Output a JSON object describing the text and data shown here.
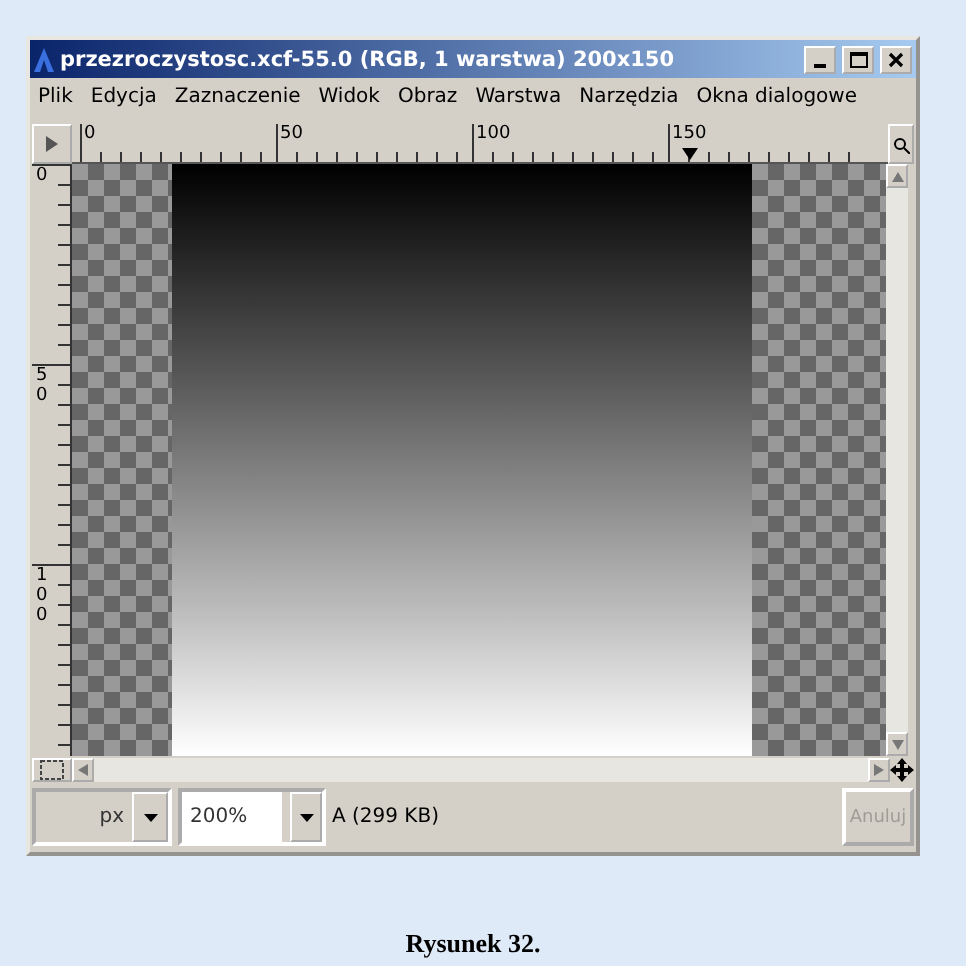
{
  "window": {
    "title": "przezroczystosc.xcf-55.0 (RGB, 1 warstwa) 200x150"
  },
  "menu": [
    "Plik",
    "Edycja",
    "Zaznaczenie",
    "Widok",
    "Obraz",
    "Warstwa",
    "Narzędzia",
    "Okna dialogowe"
  ],
  "top_ruler": [
    "0",
    "50",
    "100",
    "150"
  ],
  "left_ruler": [
    "0",
    "50",
    "100"
  ],
  "status_bar": {
    "unit": "px",
    "zoom": "200%",
    "info": "A (299 KB)",
    "cancel": {
      "label": "Anuluj",
      "disabled": true
    }
  },
  "caption": "Rysunek 32."
}
